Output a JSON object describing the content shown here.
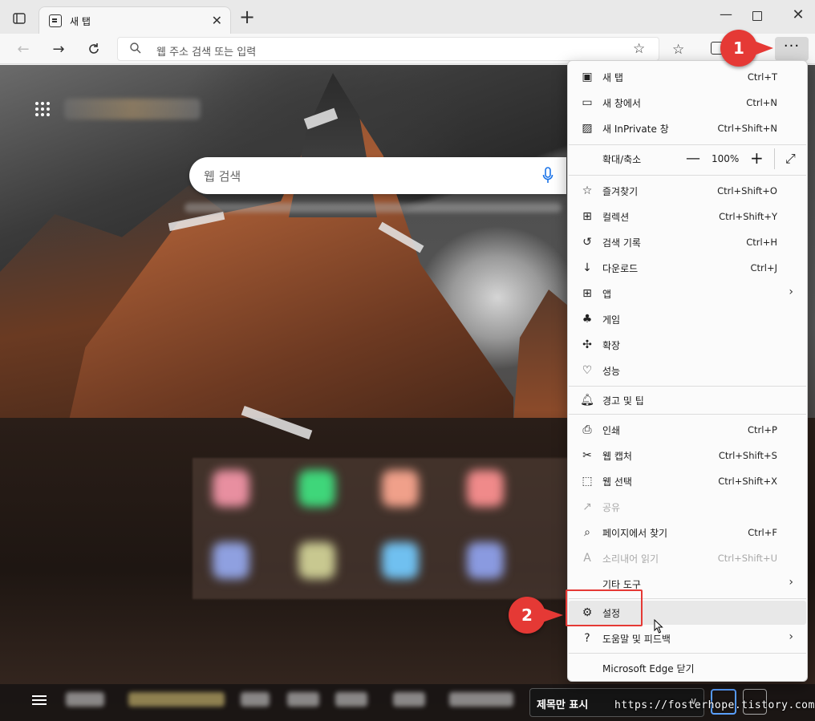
{
  "tab": {
    "title": "새 탭"
  },
  "address": {
    "placeholder": "웹 주소 검색 또는 입력"
  },
  "newtab": {
    "search_placeholder": "웹 검색",
    "layout_select": "제목만 표시",
    "watermark": "https://fosterhope.tistory.com"
  },
  "menu": {
    "items_top": [
      {
        "icon": "new-tab-icon",
        "label": "새 탭",
        "shortcut": "Ctrl+T"
      },
      {
        "icon": "new-window-icon",
        "label": "새 창에서",
        "shortcut": "Ctrl+N"
      },
      {
        "icon": "inprivate-icon",
        "label": "새 InPrivate 창",
        "shortcut": "Ctrl+Shift+N"
      }
    ],
    "zoom": {
      "label": "확대/축소",
      "value": "100%",
      "minus": "—",
      "plus": "+"
    },
    "items_mid": [
      {
        "icon": "favorites-icon",
        "label": "즐겨찾기",
        "shortcut": "Ctrl+Shift+O"
      },
      {
        "icon": "collections-icon",
        "label": "컬렉션",
        "shortcut": "Ctrl+Shift+Y"
      },
      {
        "icon": "history-icon",
        "label": "검색 기록",
        "shortcut": "Ctrl+H"
      },
      {
        "icon": "download-icon",
        "label": "다운로드",
        "shortcut": "Ctrl+J"
      },
      {
        "icon": "apps-icon",
        "label": "앱",
        "shortcut": ""
      },
      {
        "icon": "games-icon",
        "label": "게임",
        "shortcut": ""
      },
      {
        "icon": "extensions-icon",
        "label": "확장",
        "shortcut": ""
      },
      {
        "icon": "performance-icon",
        "label": "성능",
        "shortcut": ""
      }
    ],
    "alerts": {
      "icon": "bell-icon",
      "label": "경고 및 팁"
    },
    "items_bottom": [
      {
        "icon": "print-icon",
        "label": "인쇄",
        "shortcut": "Ctrl+P"
      },
      {
        "icon": "web-capture-icon",
        "label": "웹 캡처",
        "shortcut": "Ctrl+Shift+S"
      },
      {
        "icon": "web-select-icon",
        "label": "웹 선택",
        "shortcut": "Ctrl+Shift+X"
      },
      {
        "icon": "share-icon",
        "label": "공유",
        "shortcut": ""
      },
      {
        "icon": "find-icon",
        "label": "페이지에서 찾기",
        "shortcut": "Ctrl+F"
      },
      {
        "icon": "read-aloud-icon",
        "label": "소리내어 읽기",
        "shortcut": "Ctrl+Shift+U"
      },
      {
        "icon": "",
        "label": "기타 도구",
        "shortcut": ""
      },
      {
        "icon": "gear-icon",
        "label": "설정",
        "shortcut": ""
      },
      {
        "icon": "help-icon",
        "label": "도움말 및 피드백",
        "shortcut": ""
      }
    ],
    "close_label": "Microsoft Edge 닫기"
  },
  "annotations": {
    "badge1": "1",
    "badge2": "2",
    "color": "#e53935"
  }
}
